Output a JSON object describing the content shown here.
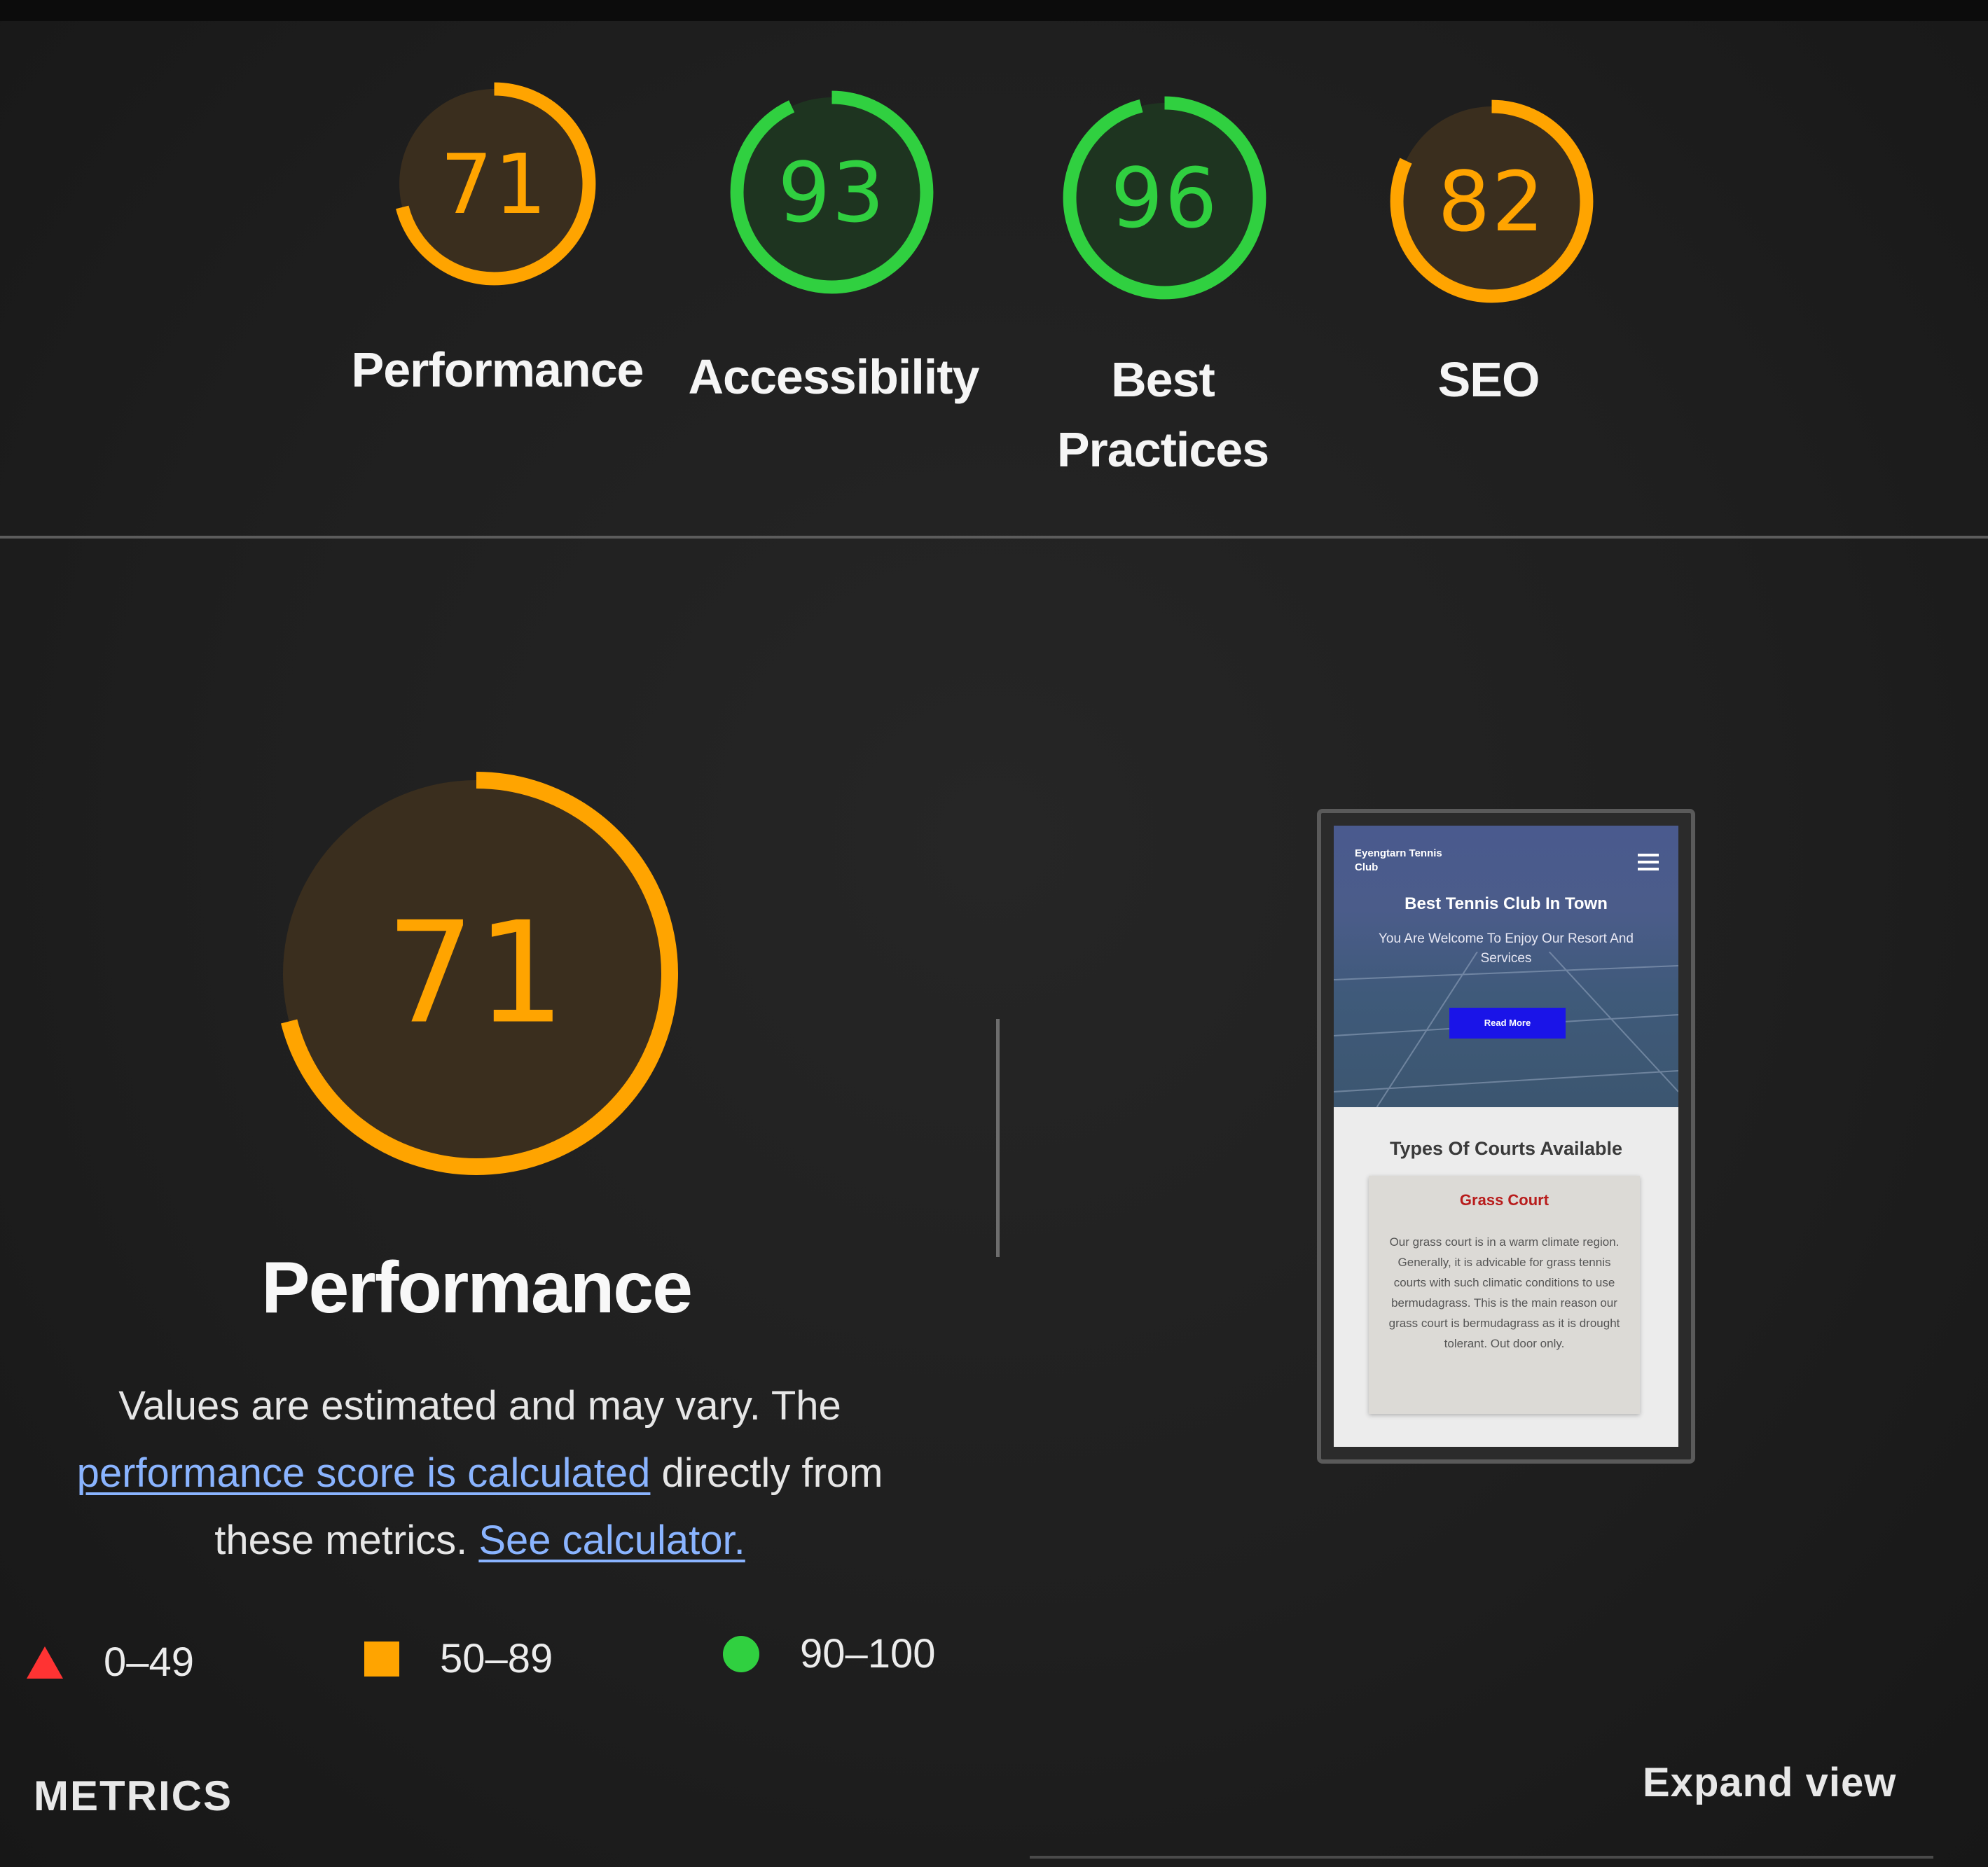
{
  "scores": [
    {
      "label": "Performance",
      "value": "71",
      "fraction": 0.71,
      "color": "#ffa400"
    },
    {
      "label": "Accessibility",
      "value": "93",
      "fraction": 0.93,
      "color": "#30d040"
    },
    {
      "label": "Best Practices",
      "value": "96",
      "fraction": 0.96,
      "color": "#30d040"
    },
    {
      "label": "SEO",
      "value": "82",
      "fraction": 0.82,
      "color": "#ffa400"
    }
  ],
  "performance": {
    "value": "71",
    "fraction": 0.71,
    "color": "#ffa400",
    "title": "Performance",
    "desc_pre": "Values are estimated and may vary. The ",
    "desc_link1": "performance score is calculated",
    "desc_mid": " directly from these metrics. ",
    "desc_link2": "See calculator."
  },
  "legend": [
    {
      "range": "0–49",
      "icon": "red-triangle-icon",
      "color": "#ff3333"
    },
    {
      "range": "50–89",
      "icon": "orange-square-icon",
      "color": "#ffa400"
    },
    {
      "range": "90–100",
      "icon": "green-circle-icon",
      "color": "#30d040"
    }
  ],
  "metrics_label": "METRICS",
  "expand_label": "Expand view",
  "screenshot": {
    "brand": "Eyengtarn Tennis Club",
    "hero_title": "Best Tennis Club In Town",
    "hero_sub": "You Are Welcome To Enjoy Our Resort And Services",
    "button": "Read More",
    "section_title": "Types Of Courts Available",
    "card_title": "Grass Court",
    "card_body": "Our grass court is in a warm climate region. Generally, it is advicable for grass tennis courts with such climatic conditions to use bermudagrass. This is the main reason our grass court is bermudagrass as it is drought tolerant. Out door only."
  }
}
